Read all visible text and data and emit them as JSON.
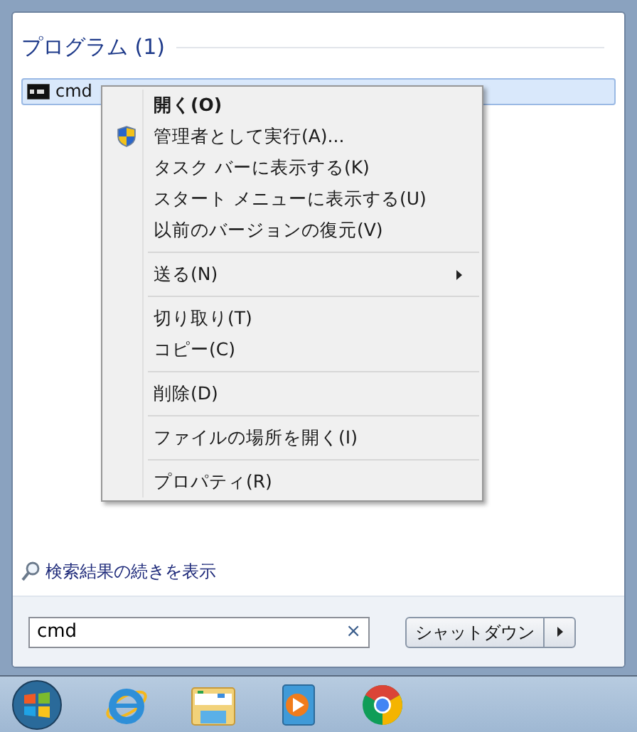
{
  "programs": {
    "heading": "プログラム (1)",
    "items": [
      {
        "label": "cmd",
        "selected": true
      }
    ]
  },
  "context_menu": {
    "groups": [
      [
        {
          "label": "開く(O)",
          "kind": "default"
        },
        {
          "label": "管理者として実行(A)...",
          "kind": "elevated"
        },
        {
          "label": "タスク バーに表示する(K)",
          "kind": "normal"
        },
        {
          "label": "スタート メニューに表示する(U)",
          "kind": "normal"
        },
        {
          "label": "以前のバージョンの復元(V)",
          "kind": "normal"
        }
      ],
      [
        {
          "label": "送る(N)",
          "kind": "submenu"
        }
      ],
      [
        {
          "label": "切り取り(T)",
          "kind": "normal"
        },
        {
          "label": "コピー(C)",
          "kind": "normal"
        }
      ],
      [
        {
          "label": "削除(D)",
          "kind": "normal"
        }
      ],
      [
        {
          "label": "ファイルの場所を開く(I)",
          "kind": "normal"
        }
      ],
      [
        {
          "label": "プロパティ(R)",
          "kind": "normal"
        }
      ]
    ]
  },
  "more_results": "検索結果の続きを表示",
  "search": {
    "value": "cmd",
    "clear": "×"
  },
  "shutdown": {
    "label": "シャットダウン"
  }
}
